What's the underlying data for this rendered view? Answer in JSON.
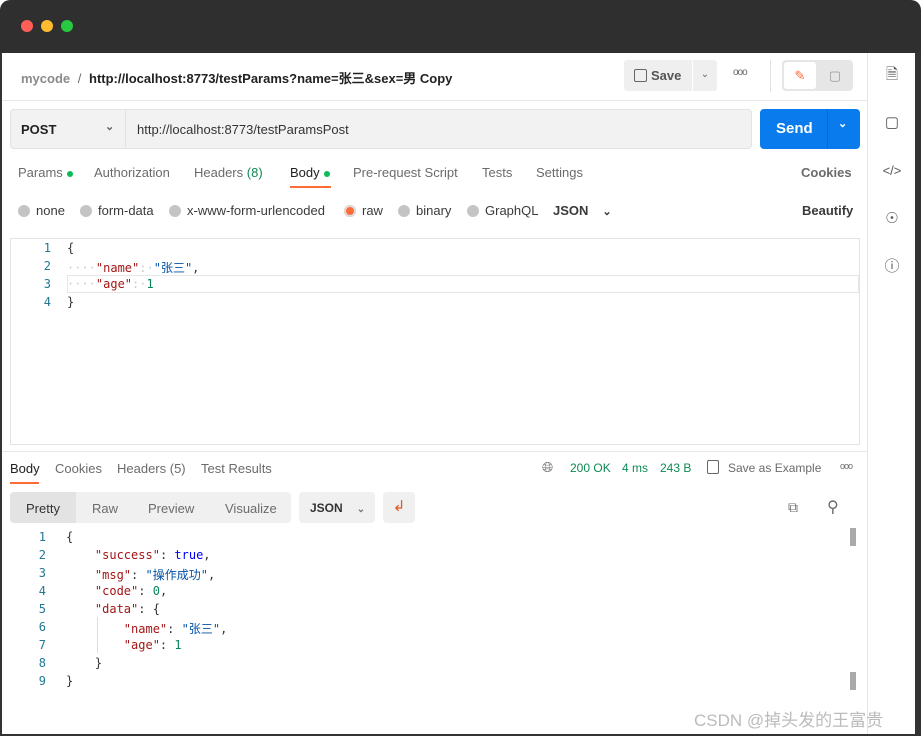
{
  "window": {
    "controls": {
      "close": "#ff5f57",
      "minimize": "#febc2e",
      "maximize": "#28c840"
    }
  },
  "breadcrumb": {
    "workspace": "mycode",
    "separator": "/",
    "title": "http://localhost:8773/testParams?name=张三&sex=男 Copy"
  },
  "toolbar": {
    "save": "Save",
    "more": "ooo"
  },
  "request": {
    "method": "POST",
    "url": "http://localhost:8773/testParamsPost",
    "send": "Send"
  },
  "tabs": [
    {
      "label": "Params",
      "dot": true
    },
    {
      "label": "Authorization"
    },
    {
      "label": "Headers",
      "count": "(8)"
    },
    {
      "label": "Body",
      "dot": true,
      "active": true
    },
    {
      "label": "Pre-request Script"
    },
    {
      "label": "Tests"
    },
    {
      "label": "Settings"
    }
  ],
  "cookies": "Cookies",
  "body_types": [
    {
      "label": "none"
    },
    {
      "label": "form-data"
    },
    {
      "label": "x-www-form-urlencoded"
    },
    {
      "label": "raw",
      "selected": true
    },
    {
      "label": "binary"
    },
    {
      "label": "GraphQL"
    }
  ],
  "format": "JSON",
  "beautify": "Beautify",
  "request_body": [
    [
      [
        "p",
        "{"
      ]
    ],
    [
      [
        "p",
        "····"
      ],
      [
        "k",
        "\"name\""
      ],
      [
        "p",
        ":·"
      ],
      [
        "s",
        "\"张三\""
      ],
      [
        "p",
        ","
      ]
    ],
    [
      [
        "p",
        "····"
      ],
      [
        "k",
        "\"age\""
      ],
      [
        "p",
        ":·"
      ],
      [
        "n",
        "1"
      ]
    ],
    [
      [
        "p",
        "}"
      ]
    ]
  ],
  "response": {
    "tabs": [
      "Body",
      "Cookies",
      "Headers (5)",
      "Test Results"
    ],
    "status": "200 OK",
    "time": "4 ms",
    "size": "243 B",
    "save_example": "Save as Example",
    "more": "ooo",
    "views": [
      "Pretty",
      "Raw",
      "Preview",
      "Visualize"
    ],
    "format": "JSON",
    "body": [
      [
        [
          "p",
          "{"
        ]
      ],
      [
        [
          "p",
          "    "
        ],
        [
          "k",
          "\"success\""
        ],
        [
          "p",
          ": "
        ],
        [
          "b",
          "true"
        ],
        [
          "p",
          ","
        ]
      ],
      [
        [
          "p",
          "    "
        ],
        [
          "k",
          "\"msg\""
        ],
        [
          "p",
          ": "
        ],
        [
          "s",
          "\"操作成功\""
        ],
        [
          "p",
          ","
        ]
      ],
      [
        [
          "p",
          "    "
        ],
        [
          "k",
          "\"code\""
        ],
        [
          "p",
          ": "
        ],
        [
          "n",
          "0"
        ],
        [
          "p",
          ","
        ]
      ],
      [
        [
          "p",
          "    "
        ],
        [
          "k",
          "\"data\""
        ],
        [
          "p",
          ": {"
        ]
      ],
      [
        [
          "p",
          "        "
        ],
        [
          "k",
          "\"name\""
        ],
        [
          "p",
          ": "
        ],
        [
          "s",
          "\"张三\""
        ],
        [
          "p",
          ","
        ]
      ],
      [
        [
          "p",
          "        "
        ],
        [
          "k",
          "\"age\""
        ],
        [
          "p",
          ": "
        ],
        [
          "n",
          "1"
        ]
      ],
      [
        [
          "p",
          "    }"
        ]
      ],
      [
        [
          "p",
          "}"
        ]
      ]
    ]
  },
  "watermark": "CSDN @掉头发的王富贵",
  "colors": {
    "accent": "#ff6c37",
    "send": "#097bed",
    "link": "#0b66d6",
    "status": "#0f8a55"
  }
}
